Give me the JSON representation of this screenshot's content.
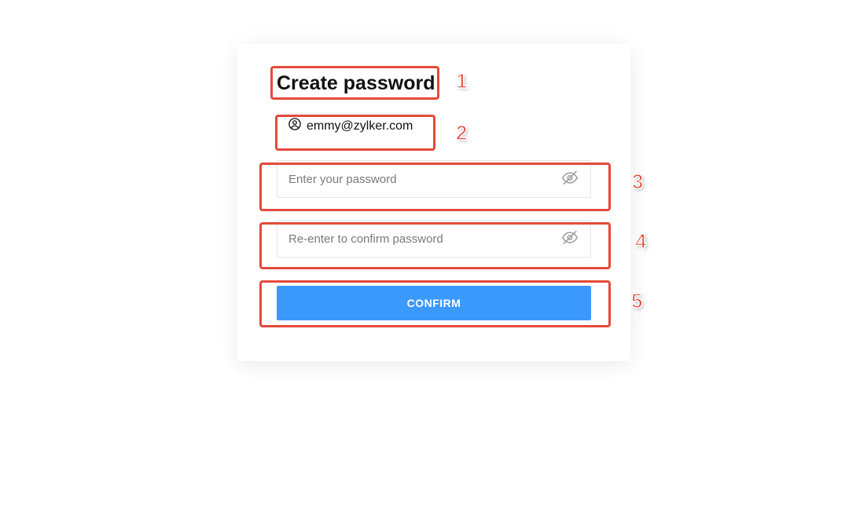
{
  "title": "Create password",
  "email": "emmy@zylker.com",
  "password": {
    "placeholder": "Enter your password",
    "value": ""
  },
  "confirmPassword": {
    "placeholder": "Re-enter to confirm password",
    "value": ""
  },
  "confirmButton": "CONFIRM",
  "annotations": {
    "n1": "1",
    "n2": "2",
    "n3": "3",
    "n4": "4",
    "n5": "5"
  }
}
